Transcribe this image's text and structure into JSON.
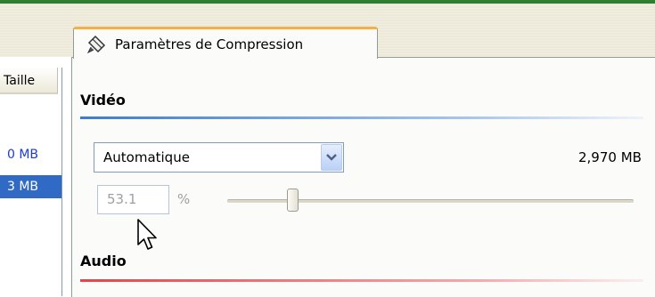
{
  "left_panel": {
    "column_header": "Taille",
    "rows": [
      {
        "label": "0 MB",
        "selected": false
      },
      {
        "label": "3 MB",
        "selected": true
      }
    ]
  },
  "tab": {
    "label": "Paramètres de Compression",
    "icon": "compression-settings-icon"
  },
  "video": {
    "section_title": "Vidéo",
    "mode_select": {
      "value": "Automatique"
    },
    "size": "2,970 MB",
    "quality": {
      "value": "53.1",
      "unit": "%",
      "slider_fraction": 0.16
    }
  },
  "audio": {
    "section_title": "Audio"
  },
  "colors": {
    "video_rule": "#3c7bd3",
    "audio_rule": "#e2454a",
    "tab_accent": "#f4b043",
    "selected_row": "#316ac5"
  }
}
